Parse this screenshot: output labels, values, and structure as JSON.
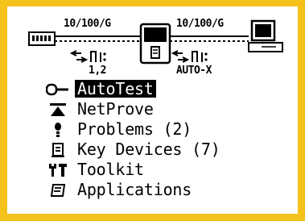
{
  "colors": {
    "bezel": "#f4c21a",
    "screen": "#ffffff",
    "ink": "#000000"
  },
  "diagram": {
    "left_link_speed": "10/100/G",
    "right_link_speed": "10/100/G",
    "left_port_label": "1,2",
    "right_port_label": "AUTO-X",
    "left_device_icon": "switch-icon",
    "center_device_icon": "tester-icon",
    "right_device_icon": "computer-icon"
  },
  "menu": {
    "items": [
      {
        "label": "AutoTest",
        "icon": "autotest-icon",
        "selected": true
      },
      {
        "label": "NetProve",
        "icon": "netprove-icon",
        "selected": false
      },
      {
        "label": "Problems (2)",
        "icon": "problems-icon",
        "selected": false
      },
      {
        "label": "Key Devices (7)",
        "icon": "key-devices-icon",
        "selected": false
      },
      {
        "label": "Toolkit",
        "icon": "toolkit-icon",
        "selected": false
      },
      {
        "label": "Applications",
        "icon": "applications-icon",
        "selected": false
      }
    ]
  }
}
